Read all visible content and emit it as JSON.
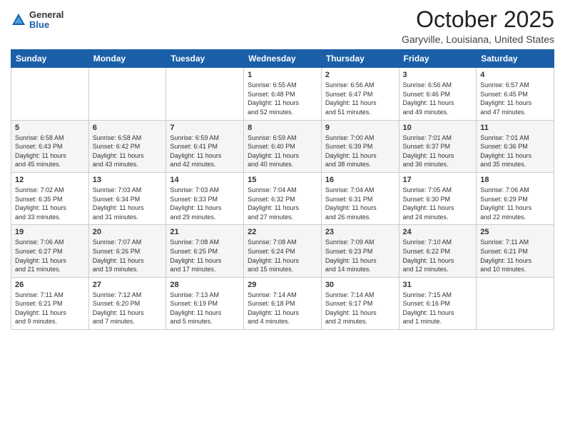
{
  "logo": {
    "general": "General",
    "blue": "Blue"
  },
  "title": {
    "month_year": "October 2025",
    "location": "Garyville, Louisiana, United States"
  },
  "days_of_week": [
    "Sunday",
    "Monday",
    "Tuesday",
    "Wednesday",
    "Thursday",
    "Friday",
    "Saturday"
  ],
  "weeks": [
    [
      {
        "day": "",
        "info": ""
      },
      {
        "day": "",
        "info": ""
      },
      {
        "day": "",
        "info": ""
      },
      {
        "day": "1",
        "info": "Sunrise: 6:55 AM\nSunset: 6:48 PM\nDaylight: 11 hours\nand 52 minutes."
      },
      {
        "day": "2",
        "info": "Sunrise: 6:56 AM\nSunset: 6:47 PM\nDaylight: 11 hours\nand 51 minutes."
      },
      {
        "day": "3",
        "info": "Sunrise: 6:56 AM\nSunset: 6:46 PM\nDaylight: 11 hours\nand 49 minutes."
      },
      {
        "day": "4",
        "info": "Sunrise: 6:57 AM\nSunset: 6:45 PM\nDaylight: 11 hours\nand 47 minutes."
      }
    ],
    [
      {
        "day": "5",
        "info": "Sunrise: 6:58 AM\nSunset: 6:43 PM\nDaylight: 11 hours\nand 45 minutes."
      },
      {
        "day": "6",
        "info": "Sunrise: 6:58 AM\nSunset: 6:42 PM\nDaylight: 11 hours\nand 43 minutes."
      },
      {
        "day": "7",
        "info": "Sunrise: 6:59 AM\nSunset: 6:41 PM\nDaylight: 11 hours\nand 42 minutes."
      },
      {
        "day": "8",
        "info": "Sunrise: 6:59 AM\nSunset: 6:40 PM\nDaylight: 11 hours\nand 40 minutes."
      },
      {
        "day": "9",
        "info": "Sunrise: 7:00 AM\nSunset: 6:39 PM\nDaylight: 11 hours\nand 38 minutes."
      },
      {
        "day": "10",
        "info": "Sunrise: 7:01 AM\nSunset: 6:37 PM\nDaylight: 11 hours\nand 36 minutes."
      },
      {
        "day": "11",
        "info": "Sunrise: 7:01 AM\nSunset: 6:36 PM\nDaylight: 11 hours\nand 35 minutes."
      }
    ],
    [
      {
        "day": "12",
        "info": "Sunrise: 7:02 AM\nSunset: 6:35 PM\nDaylight: 11 hours\nand 33 minutes."
      },
      {
        "day": "13",
        "info": "Sunrise: 7:03 AM\nSunset: 6:34 PM\nDaylight: 11 hours\nand 31 minutes."
      },
      {
        "day": "14",
        "info": "Sunrise: 7:03 AM\nSunset: 6:33 PM\nDaylight: 11 hours\nand 29 minutes."
      },
      {
        "day": "15",
        "info": "Sunrise: 7:04 AM\nSunset: 6:32 PM\nDaylight: 11 hours\nand 27 minutes."
      },
      {
        "day": "16",
        "info": "Sunrise: 7:04 AM\nSunset: 6:31 PM\nDaylight: 11 hours\nand 26 minutes."
      },
      {
        "day": "17",
        "info": "Sunrise: 7:05 AM\nSunset: 6:30 PM\nDaylight: 11 hours\nand 24 minutes."
      },
      {
        "day": "18",
        "info": "Sunrise: 7:06 AM\nSunset: 6:29 PM\nDaylight: 11 hours\nand 22 minutes."
      }
    ],
    [
      {
        "day": "19",
        "info": "Sunrise: 7:06 AM\nSunset: 6:27 PM\nDaylight: 11 hours\nand 21 minutes."
      },
      {
        "day": "20",
        "info": "Sunrise: 7:07 AM\nSunset: 6:26 PM\nDaylight: 11 hours\nand 19 minutes."
      },
      {
        "day": "21",
        "info": "Sunrise: 7:08 AM\nSunset: 6:25 PM\nDaylight: 11 hours\nand 17 minutes."
      },
      {
        "day": "22",
        "info": "Sunrise: 7:08 AM\nSunset: 6:24 PM\nDaylight: 11 hours\nand 15 minutes."
      },
      {
        "day": "23",
        "info": "Sunrise: 7:09 AM\nSunset: 6:23 PM\nDaylight: 11 hours\nand 14 minutes."
      },
      {
        "day": "24",
        "info": "Sunrise: 7:10 AM\nSunset: 6:22 PM\nDaylight: 11 hours\nand 12 minutes."
      },
      {
        "day": "25",
        "info": "Sunrise: 7:11 AM\nSunset: 6:21 PM\nDaylight: 11 hours\nand 10 minutes."
      }
    ],
    [
      {
        "day": "26",
        "info": "Sunrise: 7:11 AM\nSunset: 6:21 PM\nDaylight: 11 hours\nand 9 minutes."
      },
      {
        "day": "27",
        "info": "Sunrise: 7:12 AM\nSunset: 6:20 PM\nDaylight: 11 hours\nand 7 minutes."
      },
      {
        "day": "28",
        "info": "Sunrise: 7:13 AM\nSunset: 6:19 PM\nDaylight: 11 hours\nand 5 minutes."
      },
      {
        "day": "29",
        "info": "Sunrise: 7:14 AM\nSunset: 6:18 PM\nDaylight: 11 hours\nand 4 minutes."
      },
      {
        "day": "30",
        "info": "Sunrise: 7:14 AM\nSunset: 6:17 PM\nDaylight: 11 hours\nand 2 minutes."
      },
      {
        "day": "31",
        "info": "Sunrise: 7:15 AM\nSunset: 6:16 PM\nDaylight: 11 hours\nand 1 minute."
      },
      {
        "day": "",
        "info": ""
      }
    ]
  ]
}
